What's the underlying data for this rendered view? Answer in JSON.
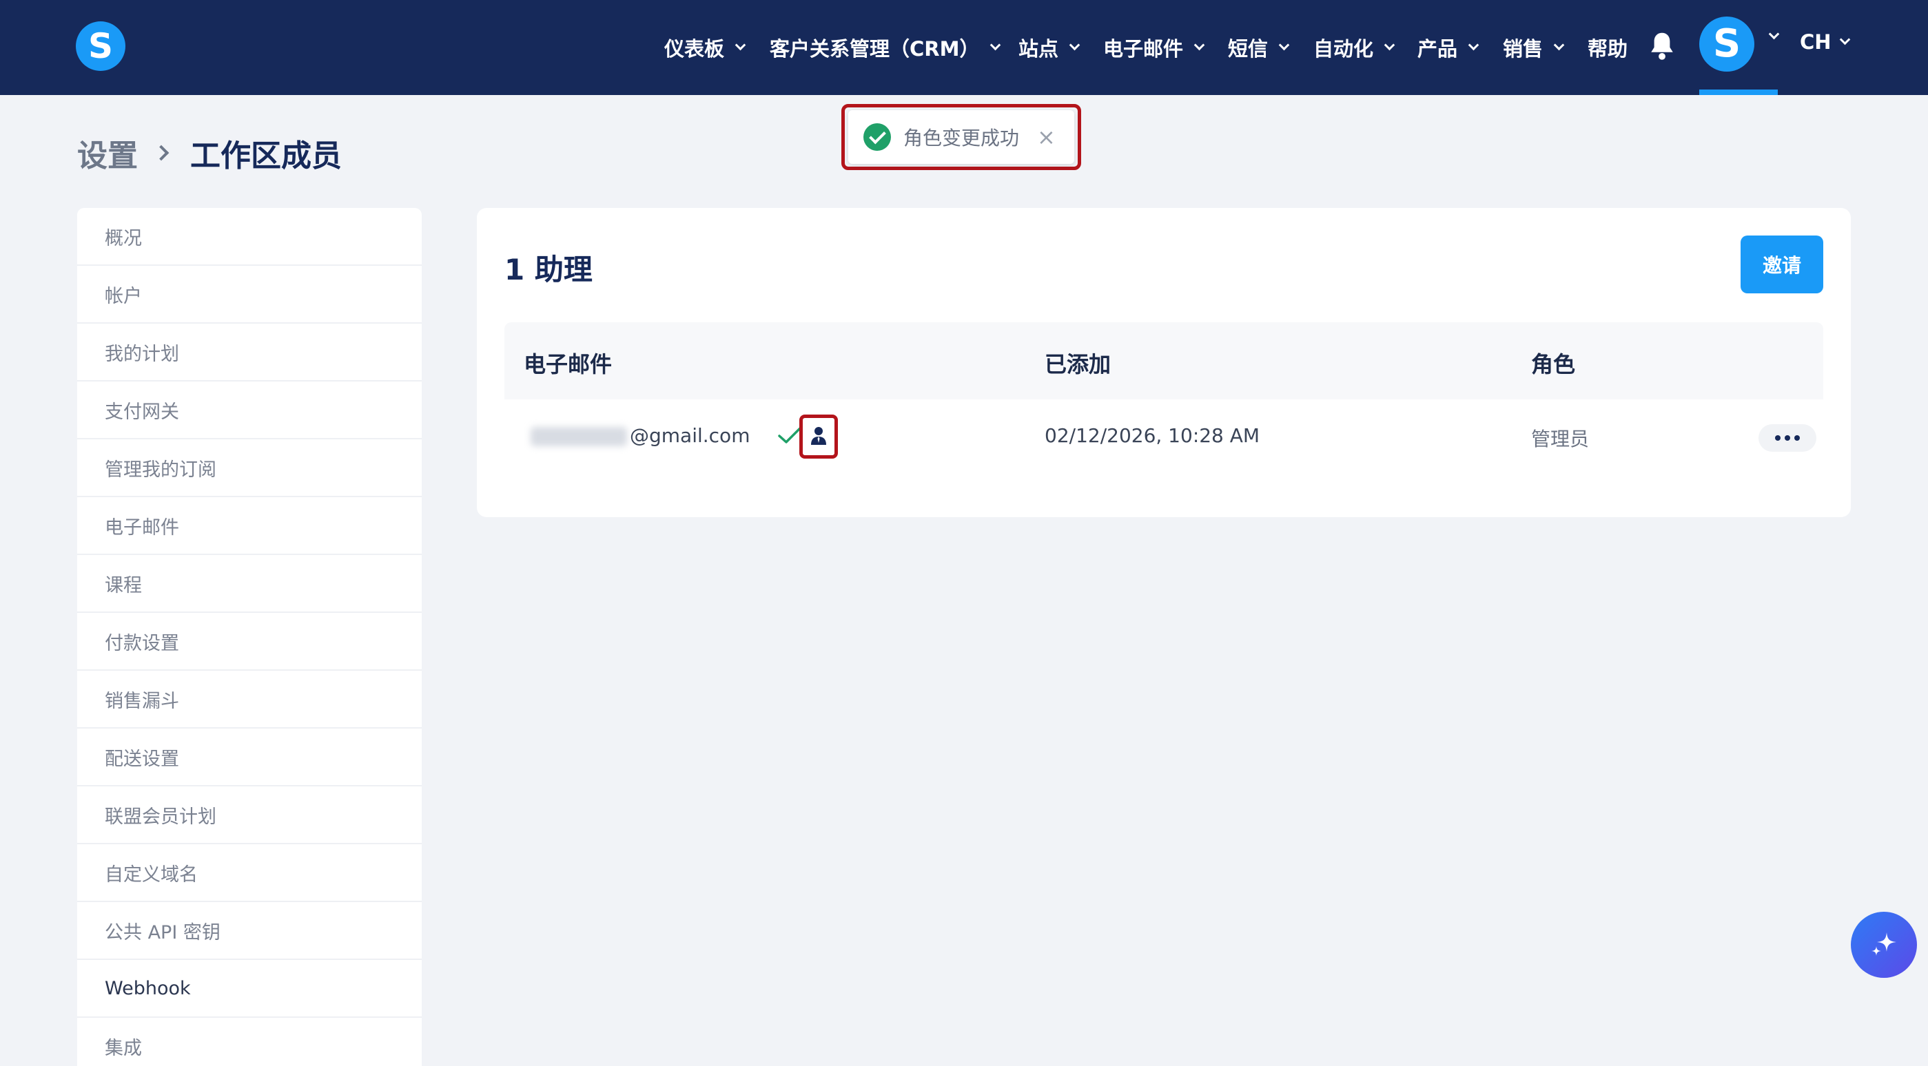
{
  "brand": {
    "logo_letter": "S"
  },
  "nav": {
    "items": [
      {
        "label": "仪表板",
        "has_dropdown": true
      },
      {
        "label": "客户关系管理（CRM）",
        "has_dropdown": true
      },
      {
        "label": "站点",
        "has_dropdown": true
      },
      {
        "label": "电子邮件",
        "has_dropdown": true
      },
      {
        "label": "短信",
        "has_dropdown": true
      },
      {
        "label": "自动化",
        "has_dropdown": true
      },
      {
        "label": "产品",
        "has_dropdown": true
      },
      {
        "label": "销售",
        "has_dropdown": true
      },
      {
        "label": "帮助",
        "has_dropdown": false
      }
    ],
    "avatar_letter": "S",
    "language": "CH"
  },
  "toast": {
    "message": "角色变更成功",
    "close": "×"
  },
  "breadcrumb": {
    "root": "设置",
    "current": "工作区成员"
  },
  "sidebar": {
    "items": [
      "概况",
      "帐户",
      "我的计划",
      "支付网关",
      "管理我的订阅",
      "电子邮件",
      "课程",
      "付款设置",
      "销售漏斗",
      "配送设置",
      "联盟会员计划",
      "自定义域名",
      "公共 API 密钥",
      "Webhook",
      "集成"
    ]
  },
  "members": {
    "title": "1 助理",
    "invite_label": "邀请",
    "columns": {
      "email": "电子邮件",
      "added": "已添加",
      "role": "角色"
    },
    "rows": [
      {
        "email_suffix": "@gmail.com",
        "added": "02/12/2026, 10:28 AM",
        "role": "管理员"
      }
    ]
  },
  "colors": {
    "nav_bg": "#16295a",
    "accent": "#1a9af7",
    "success": "#1fa068",
    "highlight": "#b3141b"
  }
}
